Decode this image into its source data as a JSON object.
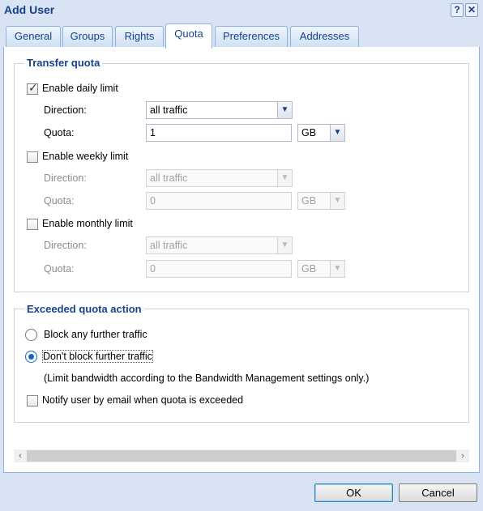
{
  "window": {
    "title": "Add User",
    "help_label": "?",
    "close_label": "✕"
  },
  "tabs": [
    {
      "label": "General",
      "active": false
    },
    {
      "label": "Groups",
      "active": false
    },
    {
      "label": "Rights",
      "active": false
    },
    {
      "label": "Quota",
      "active": true
    },
    {
      "label": "Preferences",
      "active": false
    },
    {
      "label": "Addresses",
      "active": false
    }
  ],
  "transfer_quota": {
    "title": "Transfer quota",
    "daily": {
      "label": "Enable daily limit",
      "checked": true,
      "direction_label": "Direction:",
      "direction_value": "all traffic",
      "quota_label": "Quota:",
      "quota_value": "1",
      "unit_value": "GB"
    },
    "weekly": {
      "label": "Enable weekly limit",
      "checked": false,
      "direction_label": "Direction:",
      "direction_value": "all traffic",
      "quota_label": "Quota:",
      "quota_value": "0",
      "unit_value": "GB"
    },
    "monthly": {
      "label": "Enable monthly limit",
      "checked": false,
      "direction_label": "Direction:",
      "direction_value": "all traffic",
      "quota_label": "Quota:",
      "quota_value": "0",
      "unit_value": "GB"
    }
  },
  "exceeded_action": {
    "title": "Exceeded quota action",
    "block_label": "Block any further traffic",
    "dont_block_label": "Don't block further traffic",
    "dont_block_note": "(Limit bandwidth according to the Bandwidth Management settings only.)",
    "selected": "dont_block",
    "notify_label": "Notify user by email when quota is exceeded",
    "notify_checked": false
  },
  "scrollbar": {
    "left_arrow": "‹",
    "right_arrow": "›"
  },
  "buttons": {
    "ok_label": "OK",
    "cancel_label": "Cancel"
  },
  "icons": {
    "combo_arrow": "▼"
  }
}
